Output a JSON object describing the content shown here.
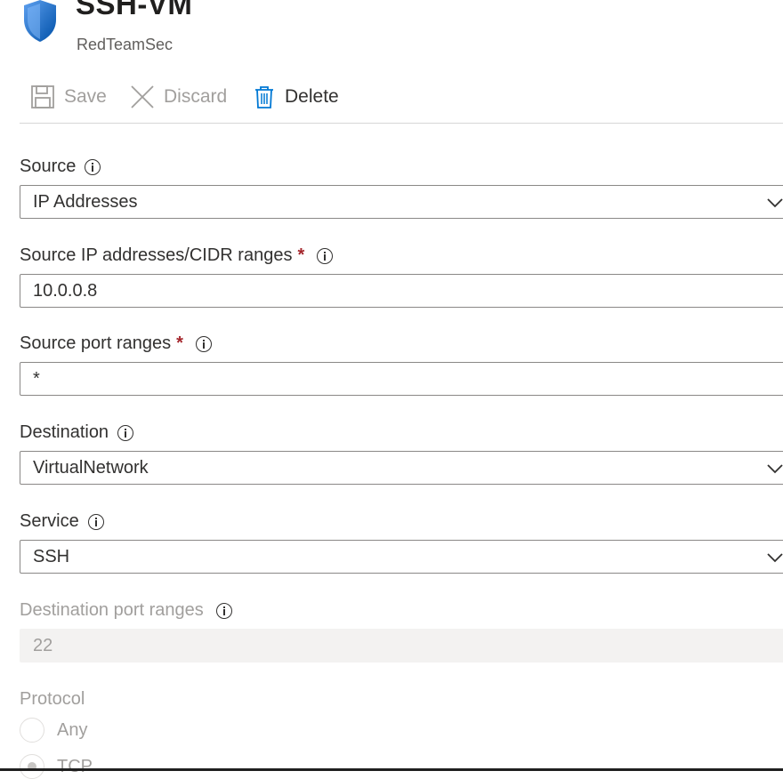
{
  "header": {
    "title": "SSH-VM",
    "subtitle": "RedTeamSec"
  },
  "toolbar": {
    "save_label": "Save",
    "discard_label": "Discard",
    "delete_label": "Delete"
  },
  "fields": {
    "source": {
      "label": "Source",
      "value": "IP Addresses"
    },
    "source_ip": {
      "label": "Source IP addresses/CIDR ranges",
      "required": "*",
      "value": "10.0.0.8"
    },
    "source_port": {
      "label": "Source port ranges",
      "required": "*",
      "value": "*"
    },
    "destination": {
      "label": "Destination",
      "value": "VirtualNetwork"
    },
    "service": {
      "label": "Service",
      "value": "SSH"
    },
    "dest_port": {
      "label": "Destination port ranges",
      "value": "22"
    },
    "protocol": {
      "label": "Protocol",
      "options": [
        "Any",
        "TCP"
      ],
      "selected": "TCP"
    }
  },
  "colors": {
    "required": "#a4262c",
    "disabled_text": "#a19f9d",
    "accent": "#0078d4"
  },
  "icons": {
    "app": "shield-icon",
    "save": "save-icon",
    "discard": "close-icon",
    "delete": "trash-icon",
    "info": "info-icon",
    "dropdown": "chevron-down-icon"
  }
}
